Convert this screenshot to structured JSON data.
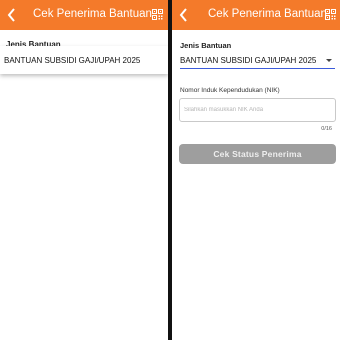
{
  "app": {
    "title": "Cek Penerima Bantuan",
    "accent_color": "#f47a2a"
  },
  "icons": {
    "back": "arrow-back-icon",
    "qr": "qr-code-icon"
  },
  "left_screen": {
    "field_label": "Jenis Bantuan",
    "dropdown_option": "BANTUAN SUBSIDI GAJI/UPAH 2025"
  },
  "right_screen": {
    "jenis_label": "Jenis Bantuan",
    "jenis_value": "BANTUAN SUBSIDI GAJI/UPAH 2025",
    "nik_label": "Nomor Induk Kependudukan (NIK)",
    "nik_placeholder": "Silahkan masukkan NIK Anda",
    "nik_value": "",
    "nik_counter": "0/16",
    "submit_label": "Cek Status Penerima"
  }
}
